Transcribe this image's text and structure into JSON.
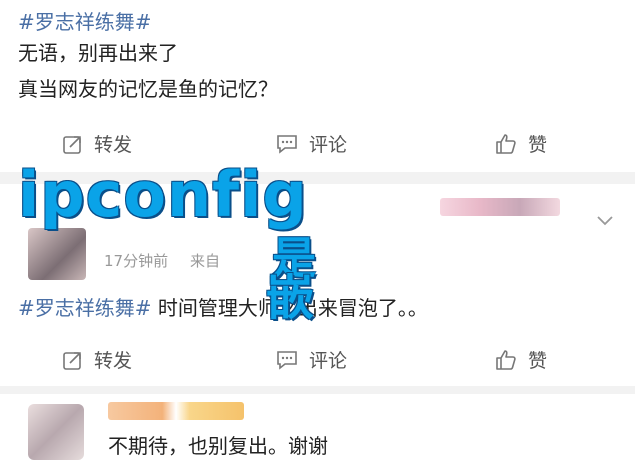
{
  "post": {
    "hashtag": "#罗志祥练舞#",
    "line1": "无语，别再出来了",
    "line2": "真当网友的记忆是鱼的记忆？"
  },
  "actions_1": {
    "repost": "转发",
    "comment": "评论",
    "like": "赞"
  },
  "overlay": {
    "word": "ipconfig",
    "cn1": "是",
    "cn2": "嵌"
  },
  "repost_card": {
    "timestamp": "17分钟前",
    "source": "来自",
    "hashtag": "#罗志祥练舞#",
    "text": " 时间管理大师又出来冒泡了。。"
  },
  "actions_2": {
    "repost": "转发",
    "comment": "评论",
    "like": "赞"
  },
  "comment": {
    "text": "不期待，也别复出。谢谢"
  },
  "colors": {
    "hashtag": "#4a6fa5",
    "overlay": "#0aa3e8",
    "divider": "#f2f2f2"
  }
}
